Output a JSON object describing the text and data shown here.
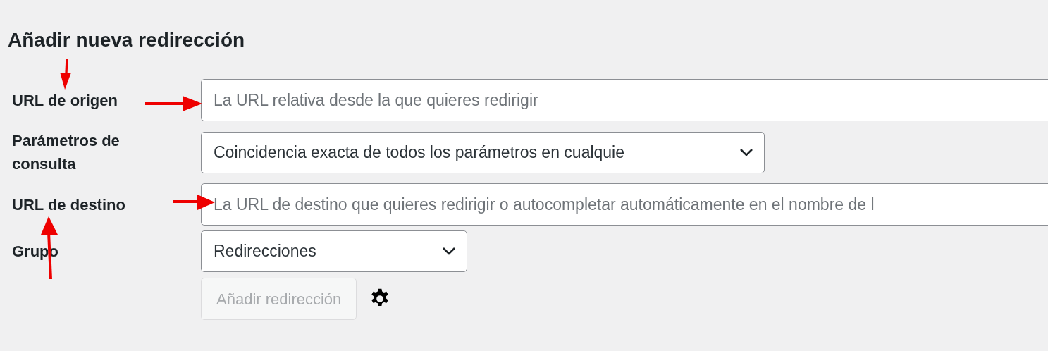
{
  "heading": "Añadir nueva redirección",
  "fields": [
    {
      "kind": "text",
      "label": "URL de origen",
      "placeholder": "La URL relativa desde la que quieres redirigir"
    },
    {
      "kind": "select",
      "label": "Parámetros de consulta",
      "value": "Coincidencia exacta de todos los parámetros en cualquie"
    },
    {
      "kind": "text",
      "label": "URL de destino",
      "placeholder": "La URL de destino que quieres redirigir o autocompletar automáticamente en el nombre de l"
    },
    {
      "kind": "select",
      "label": "Grupo",
      "value": "Redirecciones"
    }
  ],
  "submit": {
    "label": "Añadir redirección",
    "disabled": true
  }
}
